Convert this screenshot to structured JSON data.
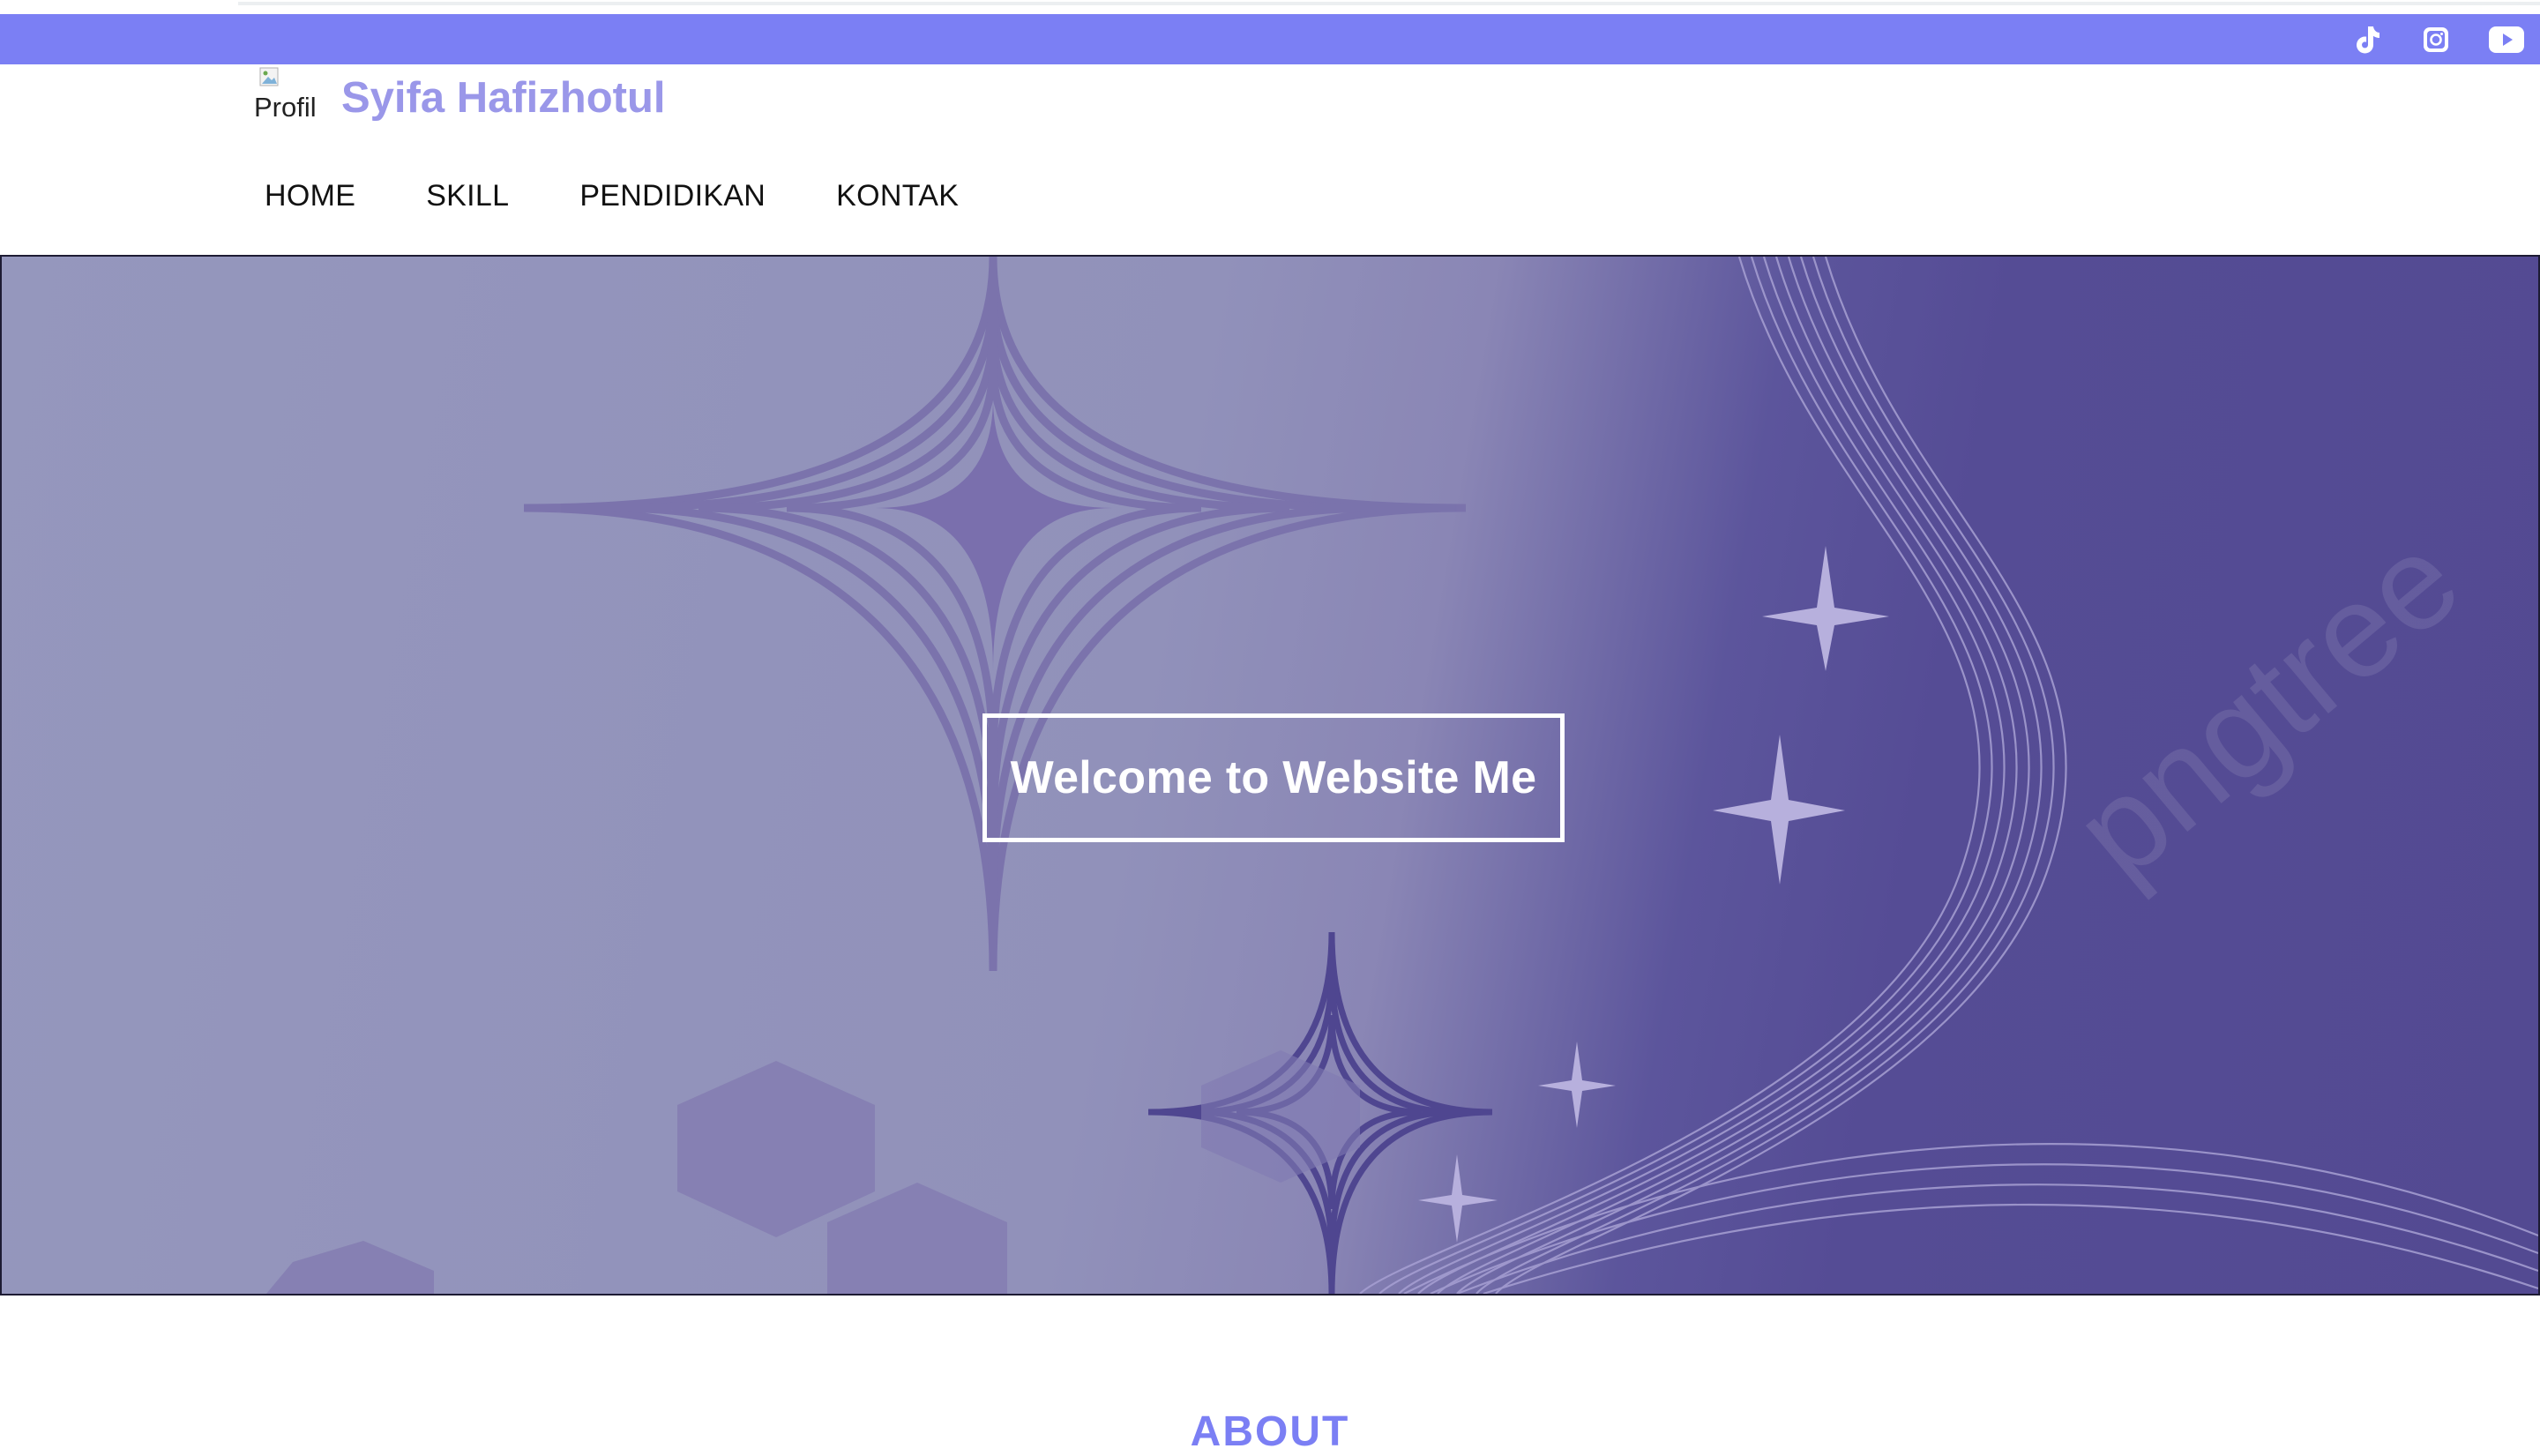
{
  "topbar": {
    "color": "#7b7ff4",
    "icons": [
      "tiktok-icon",
      "instagram-icon",
      "youtube-icon"
    ]
  },
  "brand": {
    "image_alt": "Profil",
    "name": "Syifa Hafizhotul",
    "name_color": "#9a97e9"
  },
  "nav": {
    "items": [
      "HOME",
      "SKILL",
      "PENDIDIKAN",
      "KONTAK"
    ]
  },
  "hero": {
    "welcome": "Welcome to Website Me",
    "watermark": "pngtree"
  },
  "about": {
    "heading": "ABOUT"
  }
}
